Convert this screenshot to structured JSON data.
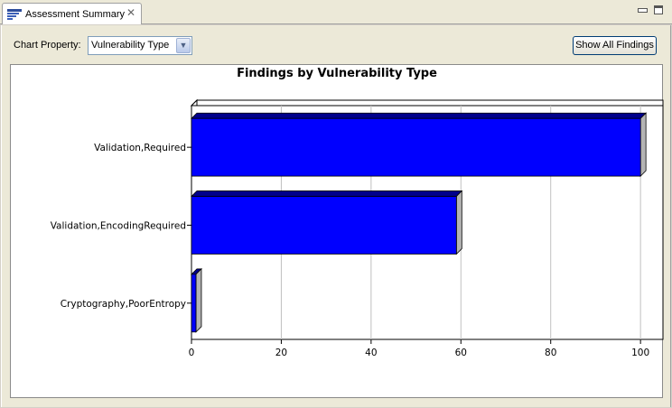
{
  "tab": {
    "label": "Assessment Summary"
  },
  "toolbar": {
    "chart_property_label": "Chart Property:",
    "chart_property_value": "Vulnerability Type",
    "show_all_label": "Show All Findings"
  },
  "chart_data": {
    "type": "bar",
    "orientation": "horizontal",
    "title": "Findings by Vulnerability Type",
    "categories": [
      "Validation,Required",
      "Validation,EncodingRequired",
      "Cryptography,PoorEntropy"
    ],
    "values": [
      100,
      59,
      1
    ],
    "xlim": [
      0,
      105
    ],
    "xticks": [
      0,
      20,
      40,
      60,
      80,
      100
    ],
    "grid": true,
    "bar_color": "#0000ff",
    "bar_side_color": "#b4b4b4"
  }
}
